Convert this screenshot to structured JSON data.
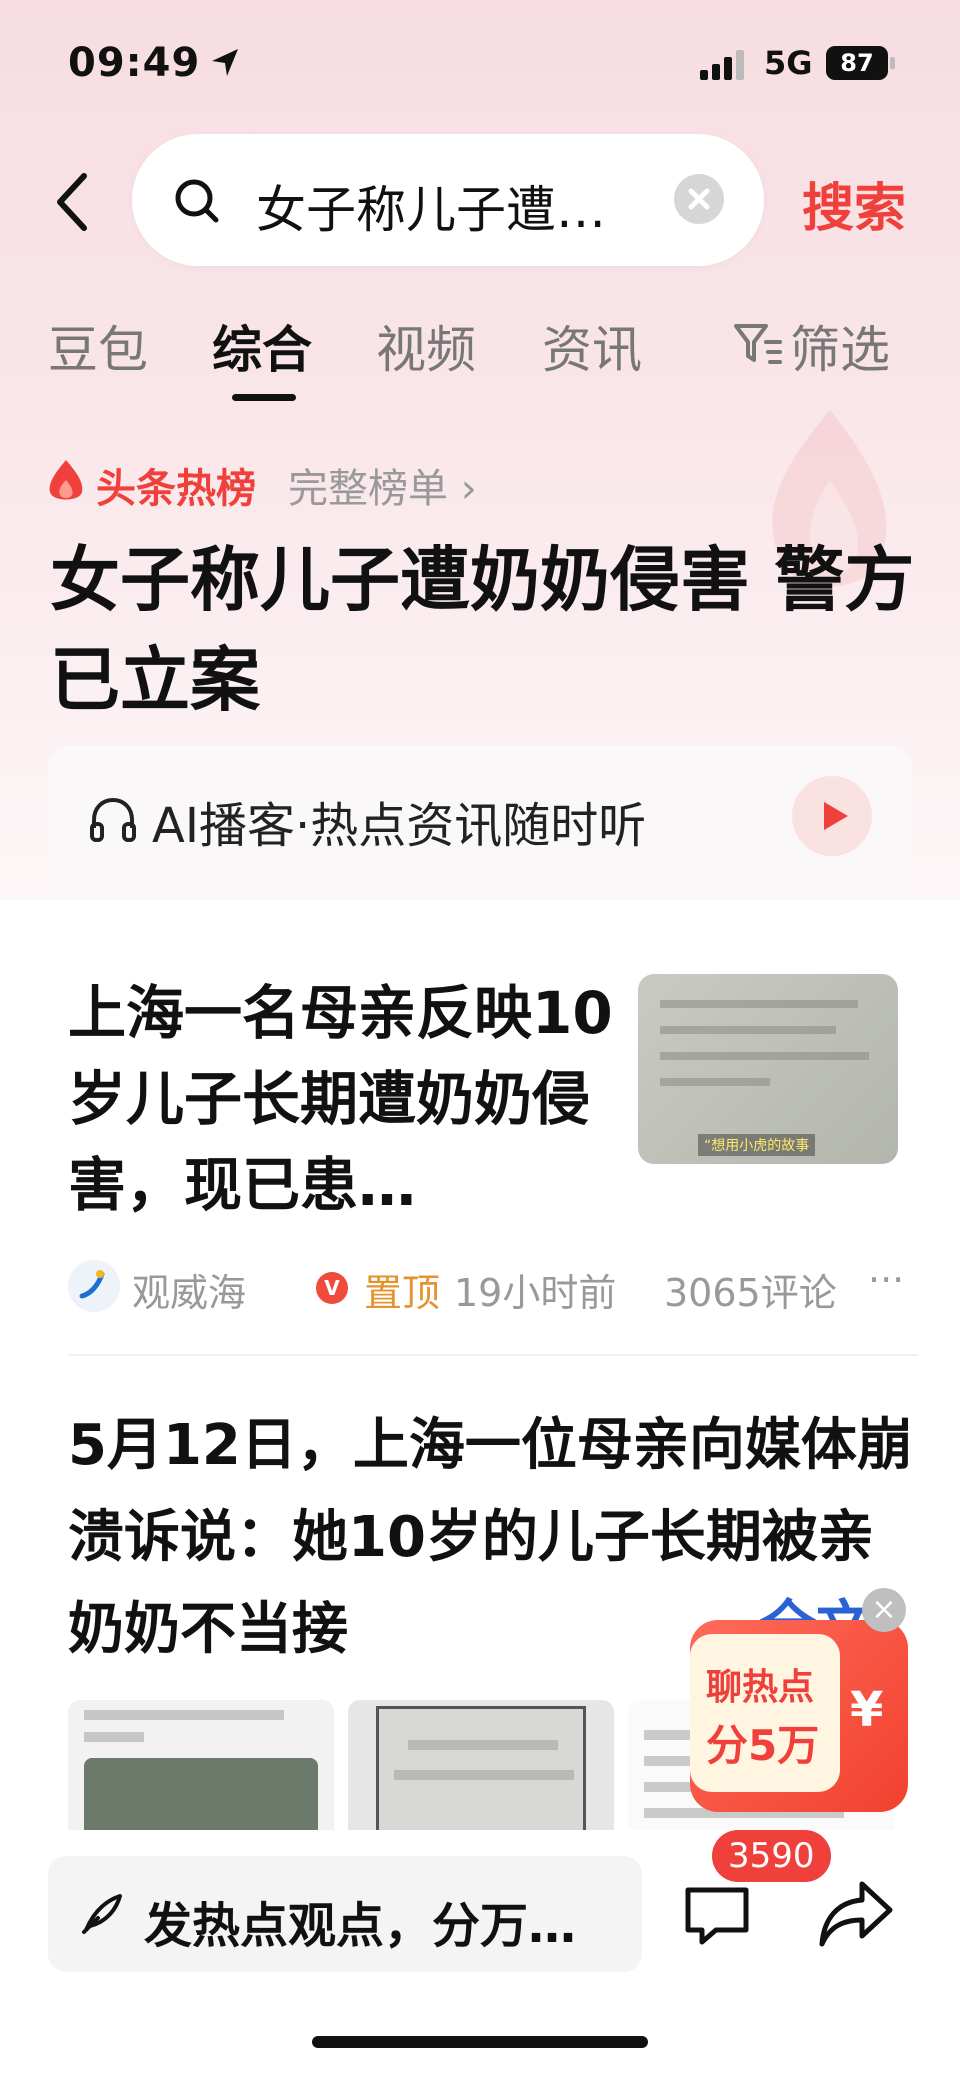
{
  "status_bar": {
    "time": "09:49",
    "network": "5G",
    "battery": "87"
  },
  "search": {
    "query": "女子称儿子遭…",
    "button_label": "搜索"
  },
  "tabs": [
    {
      "label": "豆包",
      "active": false
    },
    {
      "label": "综合",
      "active": true
    },
    {
      "label": "视频",
      "active": false
    },
    {
      "label": "资讯",
      "active": false
    }
  ],
  "filter_label": "筛选",
  "hot": {
    "label": "头条热榜",
    "full_list": "完整榜单 ›",
    "title": "女子称儿子遭奶奶侵害 警方已立案"
  },
  "ai_podcast": {
    "text": "AI播客·热点资讯随时听"
  },
  "article1": {
    "title": "上海一名母亲反映10岁儿子长期遭奶奶侵害，现已患…",
    "thumb_caption": "“想用小虎的故事",
    "author": "观威海",
    "verified": "V",
    "pinned": "置顶",
    "time": "19小时前",
    "comments": "3065评论",
    "more": "···"
  },
  "article2": {
    "text": "5月12日，上海一位母亲向媒体崩溃诉说：她10岁的儿子长期被亲奶奶不当接",
    "read_all": "全文"
  },
  "bonus": {
    "line1": "聊热点",
    "line2": "分5万",
    "currency": "¥",
    "close": "×"
  },
  "bottom": {
    "comment_placeholder": "发热点观点，分万…",
    "badge_count": "3590"
  },
  "colors": {
    "accent_red": "#f0403c",
    "pinned_orange": "#e5932c",
    "link_blue": "#2a62d6"
  },
  "icons": [
    "location-arrow-icon",
    "signal-icon",
    "battery-icon",
    "back-chevron-icon",
    "search-icon",
    "clear-icon",
    "filter-icon",
    "flame-icon",
    "headphone-icon",
    "play-icon",
    "pen-icon",
    "comment-icon",
    "share-icon"
  ]
}
